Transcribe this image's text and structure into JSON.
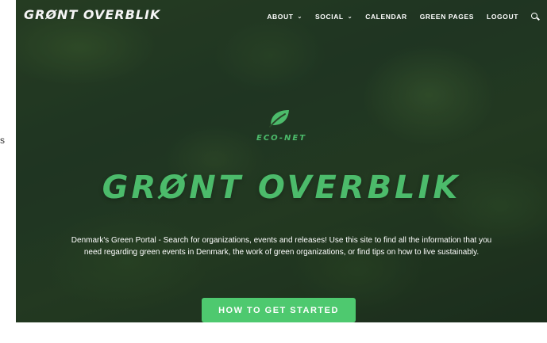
{
  "header": {
    "brand": "GRØNT OVERBLIK",
    "nav": [
      {
        "label": "ABOUT",
        "caret": "⌄"
      },
      {
        "label": "SOCIAL",
        "caret": "⌄"
      },
      {
        "label": "CALENDAR"
      },
      {
        "label": "GREEN PAGES"
      },
      {
        "label": "LOGOUT"
      }
    ],
    "search_icon": "search-icon"
  },
  "hero": {
    "leaf_icon": "leaf-icon",
    "tagline": "ECO-NET",
    "title": "GRØNT OVERBLIK",
    "description": "Denmark's Green Portal - Search for organizations, events and releases! Use this site to find all the information that you need regarding green events in Denmark, the work of green organizations, or find tips on how to live sustainably.",
    "cta_label": "HOW TO GET STARTED"
  },
  "gutter": {
    "mark": "s"
  },
  "colors": {
    "accent": "#4cbb6b",
    "button": "#4ec96f",
    "forest": "#2b4629"
  }
}
